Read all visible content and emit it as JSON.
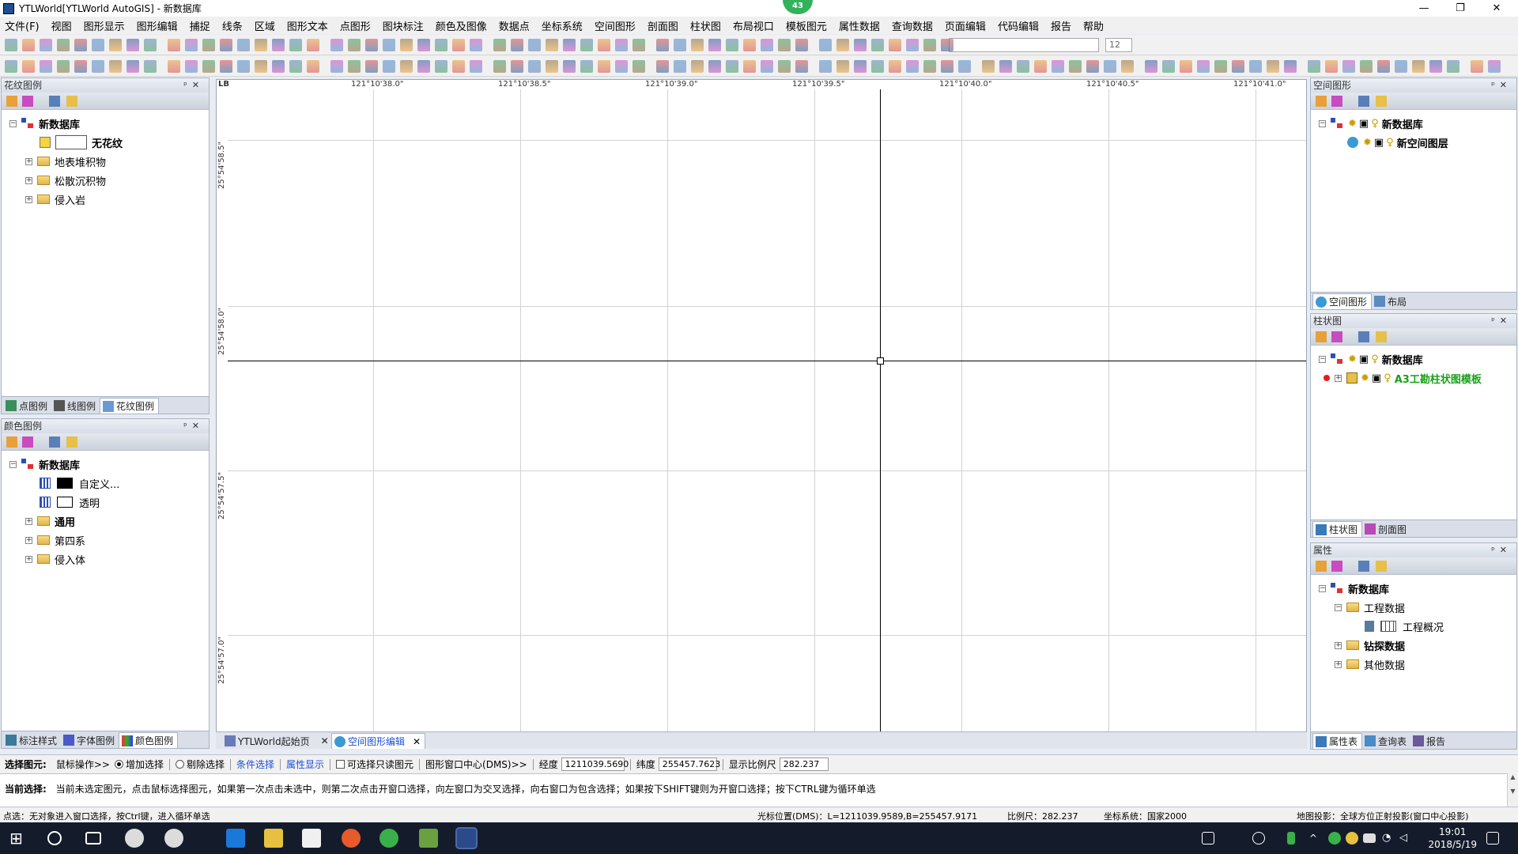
{
  "window": {
    "title": "YTLWorld[YTLWorld AutoGIS] - 新数据库",
    "badge": "43",
    "minimize": "—",
    "restore": "❐",
    "close": "✕"
  },
  "menu": [
    "文件(F)",
    "视图",
    "图形显示",
    "图形编辑",
    "捕捉",
    "线条",
    "区域",
    "图形文本",
    "点图形",
    "图块标注",
    "颜色及图像",
    "数据点",
    "坐标系统",
    "空间图形",
    "剖面图",
    "柱状图",
    "布局视口",
    "模板图元",
    "属性数据",
    "查询数据",
    "页面编辑",
    "代码编辑",
    "报告",
    "帮助"
  ],
  "toolbar": {
    "font_size": "12"
  },
  "left_top_panel": {
    "title": "花纹图例",
    "root": "新数据库",
    "items": [
      "无花纹",
      "地表堆积物",
      "松散沉积物",
      "侵入岩"
    ],
    "tabs": [
      "点图例",
      "线图例",
      "花纹图例"
    ]
  },
  "left_bottom_panel": {
    "title": "颜色图例",
    "root": "新数据库",
    "items": [
      "自定义...",
      "透明",
      "通用",
      "第四系",
      "侵入体"
    ],
    "tabs": [
      "标注样式",
      "字体图例",
      "颜色图例"
    ]
  },
  "canvas": {
    "corner": "LB",
    "x_ticks": [
      "121°10'38.0\"",
      "121°10'38.5\"",
      "121°10'39.0\"",
      "121°10'39.5\"",
      "121°10'40.0\"",
      "121°10'40.5\"",
      "121°10'41.0\""
    ],
    "y_ticks": [
      "25°54'58.5\"",
      "25°54'58.0\"",
      "25°54'57.5\"",
      "25°54'57.0\""
    ]
  },
  "doc_tabs": [
    "YTLWorld起始页",
    "空间图形编辑"
  ],
  "right_panel_1": {
    "title": "空间图形",
    "root": "新数据库",
    "child": "新空间图层",
    "tabs": [
      "空间图形",
      "布局"
    ]
  },
  "right_panel_2": {
    "title": "柱状图",
    "root": "新数据库",
    "child": "A3工勘柱状图模板",
    "tabs": [
      "柱状图",
      "剖面图"
    ]
  },
  "right_panel_3": {
    "title": "属性",
    "root": "新数据库",
    "items": [
      "工程数据",
      "工程概况",
      "钻探数据",
      "其他数据"
    ],
    "tabs": [
      "属性表",
      "查询表",
      "报告"
    ]
  },
  "selection_bar": {
    "label": "选择图元:",
    "mouse_op": "鼠标操作>>",
    "add_select": "增加选择",
    "remove_select": "剔除选择",
    "cond_select": "条件选择",
    "attr_display": "属性显示",
    "readonly_select": "可选择只读图元",
    "window_center": "图形窗口中心(DMS)>>",
    "lon_label": "经度",
    "lon_value": "1211039.5690",
    "lat_label": "纬度",
    "lat_value": "255457.7623",
    "scale_label": "显示比例尺",
    "scale_value": "282.237"
  },
  "hint": {
    "label": "当前选择:",
    "text": "当前未选定图元，点击鼠标选择图元，如果第一次点击未选中，则第二次点击开窗口选择，向左窗口为交叉选择，向右窗口为包含选择；如果按下SHIFT键则为开窗口选择；按下CTRL键为循环单选"
  },
  "status": {
    "left": "点选：无对象进入窗口选择，按Ctrl键，进入循环单选",
    "cursor": "光标位置(DMS)：L=1211039.9589,B=255457.9171",
    "scale": "比例尺：282.237",
    "coord_sys": "坐标系统：国家2000",
    "projection": "地图投影：全球方位正射投影(窗口中心投影)"
  },
  "taskbar": {
    "time": "19:01",
    "date": "2018/5/19"
  }
}
